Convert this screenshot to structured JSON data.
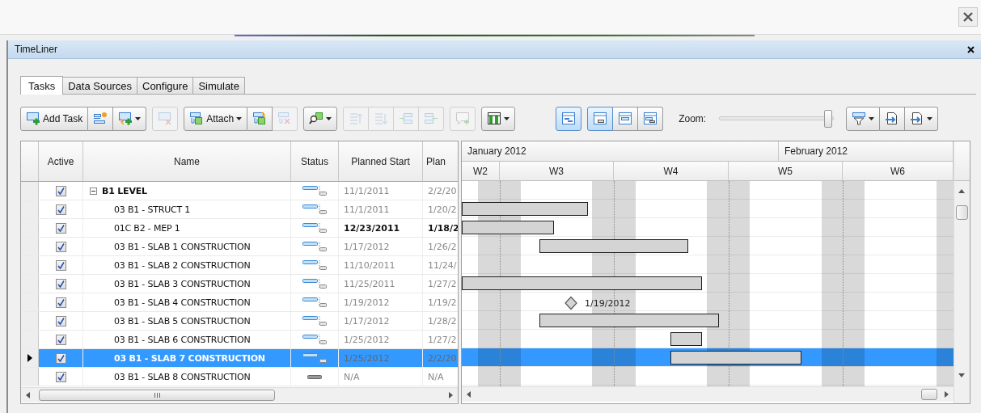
{
  "window": {
    "title": "TimeLiner"
  },
  "tabs": [
    {
      "label": "Tasks",
      "selected": true
    },
    {
      "label": "Data Sources",
      "selected": false
    },
    {
      "label": "Configure",
      "selected": false
    },
    {
      "label": "Simulate",
      "selected": false
    }
  ],
  "toolbar": {
    "left_groups": [
      {
        "buttons": [
          {
            "label": "Add Task",
            "dropdown": false,
            "disabled": false,
            "selected": false
          },
          {
            "dropdown": false,
            "disabled": false,
            "selected": false
          },
          {
            "dropdown": true,
            "disabled": false,
            "selected": false
          }
        ]
      },
      {
        "buttons": [
          {
            "dropdown": false,
            "disabled": true,
            "selected": false
          }
        ]
      },
      {
        "buttons": [
          {
            "label": "Attach",
            "dropdown": true,
            "disabled": false,
            "selected": false
          },
          {
            "dropdown": false,
            "disabled": false,
            "selected": false
          },
          {
            "dropdown": false,
            "disabled": true,
            "selected": false
          }
        ]
      },
      {
        "buttons": [
          {
            "dropdown": true,
            "disabled": false,
            "selected": false
          }
        ]
      },
      {
        "buttons": [
          {
            "dropdown": false,
            "disabled": true,
            "selected": false
          },
          {
            "dropdown": false,
            "disabled": true,
            "selected": false
          },
          {
            "dropdown": false,
            "disabled": true,
            "selected": false
          },
          {
            "dropdown": false,
            "disabled": true,
            "selected": false
          }
        ]
      },
      {
        "buttons": [
          {
            "dropdown": false,
            "disabled": true,
            "selected": false
          }
        ]
      },
      {
        "buttons": [
          {
            "dropdown": true,
            "disabled": false,
            "selected": false
          }
        ]
      },
      {
        "buttons": [
          {
            "dropdown": false,
            "disabled": false,
            "selected": true
          }
        ]
      },
      {
        "buttons": [
          {
            "dropdown": false,
            "disabled": false,
            "selected": true
          },
          {
            "dropdown": false,
            "disabled": false,
            "selected": false
          },
          {
            "dropdown": false,
            "disabled": false,
            "selected": false
          }
        ]
      }
    ],
    "zoom": {
      "label": "Zoom:",
      "level": 0.95
    },
    "right_groups": [
      {
        "buttons": [
          {
            "dropdown": true,
            "disabled": false,
            "selected": false
          },
          {
            "dropdown": false,
            "disabled": false,
            "selected": false
          },
          {
            "dropdown": true,
            "disabled": false,
            "selected": false
          }
        ]
      }
    ]
  },
  "grid": {
    "columns": [
      "Active",
      "Name",
      "Status",
      "Planned Start",
      "Plan"
    ],
    "rows": [
      {
        "active": true,
        "name": "B1 LEVEL",
        "expanded": true,
        "planned": true,
        "planned_start": "11/1/2011",
        "column_5": "2/2/20",
        "emphasized": false,
        "selected": false,
        "children": [
          {
            "active": true,
            "name": "03 B1 - STRUCT 1",
            "planned": true,
            "planned_start": "11/1/2011",
            "column_5": "1/20/2",
            "emphasized": false,
            "selected": false,
            "kind": "bar"
          },
          {
            "active": true,
            "name": "01C B2 - MEP 1",
            "planned": true,
            "planned_start": "12/23/2011",
            "column_5": "1/18/2",
            "emphasized": true,
            "selected": false,
            "kind": "bar"
          },
          {
            "active": true,
            "name": "03 B1 - SLAB 1 CONSTRUCTION",
            "planned": true,
            "planned_start": "1/17/2012",
            "column_5": "1/26/2",
            "emphasized": false,
            "selected": false,
            "kind": "bar"
          },
          {
            "active": true,
            "name": "03 B1 - SLAB 2 CONSTRUCTION",
            "planned": true,
            "planned_start": "11/10/2011",
            "column_5": "11/24/",
            "emphasized": false,
            "selected": false
          },
          {
            "active": true,
            "name": "03 B1 - SLAB 3 CONSTRUCTION",
            "planned": true,
            "planned_start": "11/25/2011",
            "column_5": "1/27/2",
            "emphasized": false,
            "selected": false,
            "kind": "bar"
          },
          {
            "active": true,
            "name": "03 B1 - SLAB 4 CONSTRUCTION",
            "planned": true,
            "planned_start": "1/19/2012",
            "column_5": "1/19/2",
            "emphasized": false,
            "selected": false,
            "kind": "milestone",
            "milestone_label": "1/19/2012"
          },
          {
            "active": true,
            "name": "03 B1 - SLAB 5 CONSTRUCTION",
            "planned": true,
            "planned_start": "1/17/2012",
            "column_5": "1/28/2",
            "emphasized": false,
            "selected": false,
            "kind": "bar"
          },
          {
            "active": true,
            "name": "03 B1 - SLAB 6 CONSTRUCTION",
            "planned": true,
            "planned_start": "1/25/2012",
            "column_5": "1/27/2",
            "emphasized": false,
            "selected": false,
            "kind": "bar"
          },
          {
            "active": true,
            "name": "03 B1 - SLAB 7 CONSTRUCTION",
            "planned": true,
            "planned_start": "1/25/2012",
            "column_5": "2/2/20",
            "emphasized": false,
            "selected": true,
            "kind": "bar"
          },
          {
            "active": true,
            "name": "03 B1 - SLAB 8 CONSTRUCTION",
            "planned": false,
            "planned_start": "N/A",
            "column_5": "N/A",
            "emphasized": false,
            "selected": false
          }
        ]
      }
    ]
  },
  "gantt": {
    "months": [
      "January 2012",
      "February 2012"
    ],
    "weeks": [
      "W2",
      "W3",
      "W4",
      "W5",
      "W6"
    ]
  }
}
